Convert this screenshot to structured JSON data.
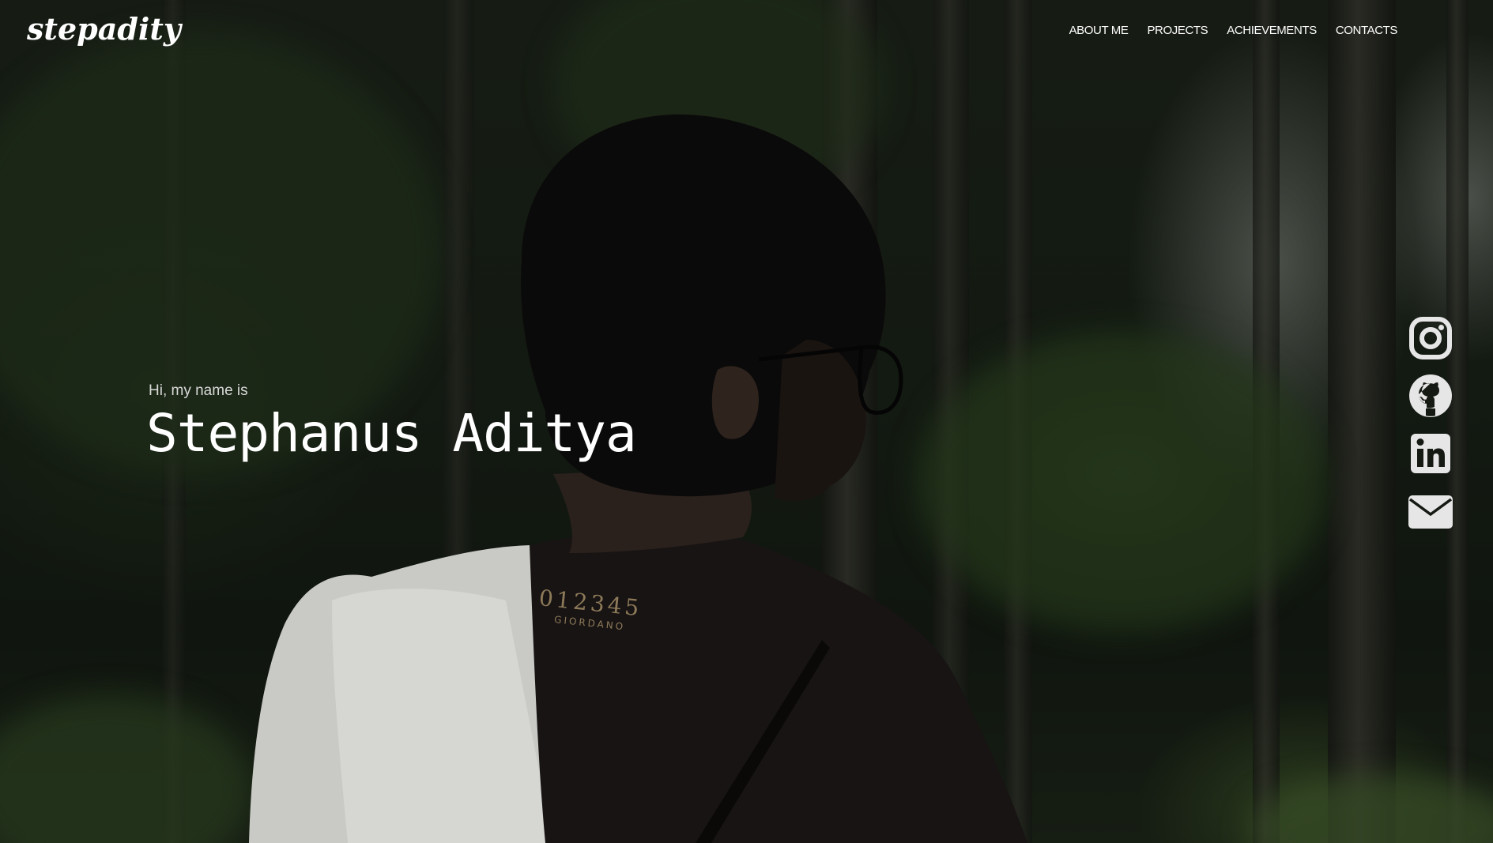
{
  "header": {
    "logo": "stepadity",
    "nav": [
      {
        "label": "ABOUT ME"
      },
      {
        "label": "PROJECTS"
      },
      {
        "label": "ACHIEVEMENTS"
      },
      {
        "label": "CONTACTS"
      }
    ]
  },
  "hero": {
    "greeting": "Hi, my name is",
    "name": "Stephanus Aditya",
    "shirt_print": {
      "digits": "012345",
      "brand": "GIORDANO"
    }
  },
  "socials": [
    {
      "icon": "instagram-icon"
    },
    {
      "icon": "github-icon"
    },
    {
      "icon": "linkedin-icon"
    },
    {
      "icon": "email-icon"
    }
  ],
  "colors": {
    "text": "#ffffff",
    "muted_text": "#d8d8d8",
    "icon": "#e6e6e6",
    "background": "#131a12"
  }
}
